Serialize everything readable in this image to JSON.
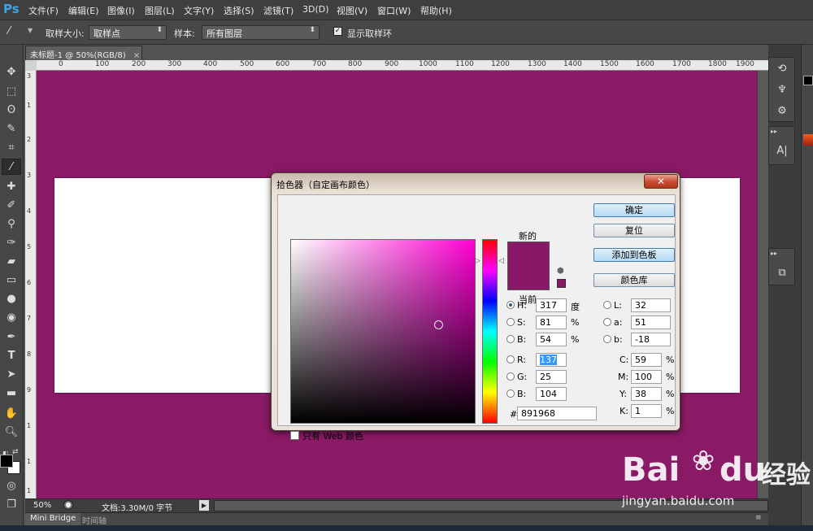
{
  "app": {
    "logo": "Ps"
  },
  "menu": [
    "文件(F)",
    "编辑(E)",
    "图像(I)",
    "图层(L)",
    "文字(Y)",
    "选择(S)",
    "滤镜(T)",
    "3D(D)",
    "视图(V)",
    "窗口(W)",
    "帮助(H)"
  ],
  "options": {
    "sample_size_label": "取样大小:",
    "sample_size_value": "取样点",
    "sample_label": "样本:",
    "sample_value": "所有图层",
    "show_ring_label": "显示取样环",
    "show_ring_checked": true
  },
  "document": {
    "tab_title": "未标题-1 @ 50%(RGB/8)",
    "canvas_color": "#8a1a65",
    "ruler_h": [
      "0",
      "100",
      "200",
      "300",
      "400",
      "500",
      "600",
      "700",
      "800",
      "900",
      "1000",
      "1100",
      "1200",
      "1300",
      "1400",
      "1500",
      "1600",
      "1700",
      "1800",
      "1900"
    ],
    "ruler_v": [
      "3",
      "1",
      "2",
      "3",
      "4",
      "5",
      "6",
      "7",
      "8",
      "9",
      "1",
      "1",
      "1"
    ]
  },
  "status": {
    "zoom": "50%",
    "doc_info": "文档:3.30M/0 字节"
  },
  "bottom_tabs": [
    "Mini Bridge",
    "时间轴"
  ],
  "dialog": {
    "title": "拾色器（自定画布颜色）",
    "label_new": "新的",
    "label_current": "当前",
    "color_hex_value": "#891968",
    "buttons": {
      "ok": "确定",
      "reset": "复位",
      "add_swatch": "添加到色板",
      "color_libraries": "颜色库"
    },
    "hsb": [
      {
        "label": "H:",
        "value": "317",
        "unit": "度",
        "selected": true
      },
      {
        "label": "S:",
        "value": "81",
        "unit": "%",
        "selected": false
      },
      {
        "label": "B:",
        "value": "54",
        "unit": "%",
        "selected": false
      }
    ],
    "rgb": [
      {
        "label": "R:",
        "value": "137"
      },
      {
        "label": "G:",
        "value": "25"
      },
      {
        "label": "B:",
        "value": "104"
      }
    ],
    "lab": [
      {
        "label": "L:",
        "value": "32"
      },
      {
        "label": "a:",
        "value": "51"
      },
      {
        "label": "b:",
        "value": "-18"
      }
    ],
    "cmyk": [
      {
        "label": "C:",
        "value": "59",
        "unit": "%"
      },
      {
        "label": "M:",
        "value": "100",
        "unit": "%"
      },
      {
        "label": "Y:",
        "value": "38",
        "unit": "%"
      },
      {
        "label": "K:",
        "value": "1",
        "unit": "%"
      }
    ],
    "hex_label": "#",
    "hex_value": "891968",
    "web_only_label": "只有 Web 颜色"
  },
  "watermark": {
    "brand": "Bai",
    "brand2": "du",
    "cn": "经验",
    "url": "jingyan.baidu.com"
  },
  "icons": [
    "eyedropper-icon",
    "move-icon",
    "marquee-icon",
    "lasso-icon",
    "quick-select-icon",
    "crop-icon",
    "brush-icon",
    "stamp-icon",
    "eraser-icon",
    "gradient-icon",
    "pen-icon",
    "type-icon",
    "hand-icon",
    "zoom-icon"
  ]
}
